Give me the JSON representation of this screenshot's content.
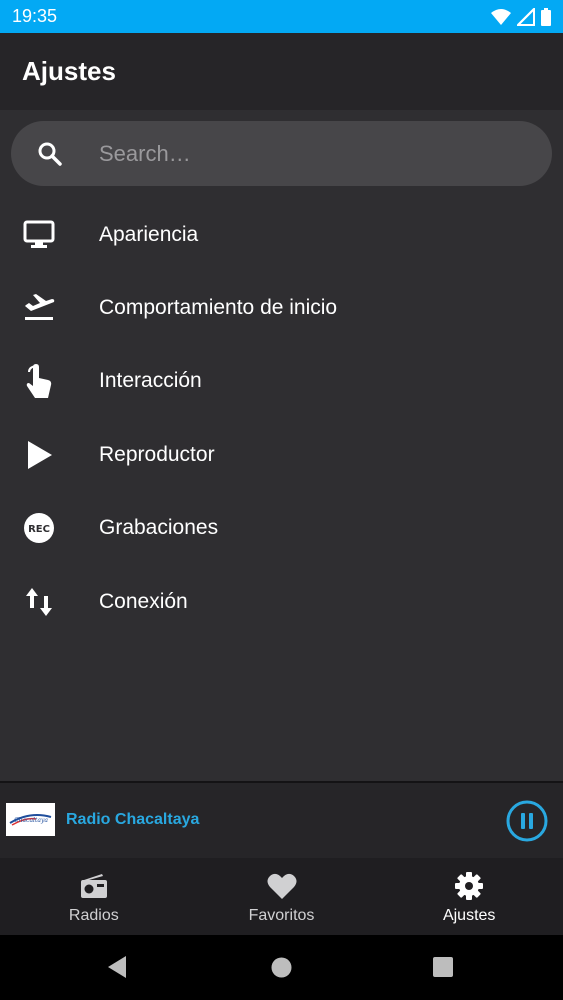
{
  "status_bar": {
    "time": "19:35",
    "icons": [
      "wifi-icon",
      "signal-icon",
      "battery-icon"
    ],
    "background": "#03a9f4"
  },
  "app_bar": {
    "title": "Ajustes"
  },
  "search": {
    "placeholder": "Search…",
    "icon": "search-icon"
  },
  "menu": {
    "items": [
      {
        "label": "Apariencia",
        "icon": "monitor-icon"
      },
      {
        "label": "Comportamiento de inicio",
        "icon": "flight-takeoff-icon"
      },
      {
        "label": "Interacción",
        "icon": "touch-icon"
      },
      {
        "label": "Reproductor",
        "icon": "play-icon"
      },
      {
        "label": "Grabaciones",
        "icon": "rec-icon",
        "icon_text": "REC"
      },
      {
        "label": "Conexión",
        "icon": "swap-vertical-icon"
      }
    ]
  },
  "now_playing": {
    "station_name": "Radio Chacaltaya",
    "logo_text": "Chacaltaya",
    "accent": "#29a8e0",
    "state": "playing"
  },
  "bottom_nav": {
    "items": [
      {
        "label": "Radios",
        "icon": "radio-icon",
        "active": false
      },
      {
        "label": "Favoritos",
        "icon": "heart-icon",
        "active": false
      },
      {
        "label": "Ajustes",
        "icon": "gear-icon",
        "active": true
      }
    ]
  },
  "system_nav": {
    "buttons": [
      "back-icon",
      "home-icon",
      "recents-icon"
    ]
  }
}
